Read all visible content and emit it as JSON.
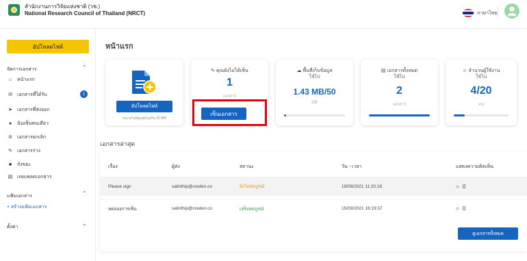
{
  "header": {
    "org_th": "สำนักงานการวิจัยแห่งชาติ (วช.)",
    "org_en": "National Research Council of Thailand (NRCT)",
    "language": "ภาษาไทย"
  },
  "sidebar": {
    "upload_label": "อัปโหลดไฟล์",
    "manage_section": "จัดการเอกสาร",
    "items": [
      {
        "label": "หน้าแรก",
        "icon": "home-icon"
      },
      {
        "label": "เอกสารที่ได้รับ",
        "icon": "inbox-icon",
        "badge": "1"
      },
      {
        "label": "เอกสารที่ส่งออก",
        "icon": "send-icon"
      },
      {
        "label": "ฉันเซ็นคนเดียว",
        "icon": "person-icon"
      },
      {
        "label": "เอกสารยกเลิก",
        "icon": "cancel-icon"
      },
      {
        "label": "เอกสารร่าง",
        "icon": "draft-icon"
      },
      {
        "label": "ถังขยะ",
        "icon": "trash-icon"
      },
      {
        "label": "เทมเพลตเอกสาร",
        "icon": "template-icon"
      }
    ],
    "template_section": "แฟ้มเอกสาร",
    "create_template": "+ สร้างแฟ้มเอกสาร",
    "settings_section": "ตั้งค่า"
  },
  "main": {
    "page_title": "หน้าแรก",
    "upload_card": {
      "button": "อัปโหลดไฟล์",
      "hint": "ขนาดไฟล์สูงสุดไม่เกิน 25 MB"
    },
    "stats": [
      {
        "label": "คุณยังไม่ได้เซ็น",
        "sublabel": "",
        "value": "1",
        "unit": "เอกสาร",
        "fill": 0
      },
      {
        "label": "พื้นที่เก็บข้อมูล",
        "sublabel": "ใช้ไป",
        "value": "1.43 MB/50",
        "unit": "GB",
        "fill": 0.03
      },
      {
        "label": "เอกสารทั้งหมด",
        "sublabel": "ใช้ไป",
        "value": "2",
        "unit": "เอกสาร",
        "fill": 1
      },
      {
        "label": "จำนวนผู้ใช้งาน",
        "sublabel": "ใช้ไป",
        "value": "4/20",
        "unit": "คน",
        "fill": 0.2
      }
    ],
    "sign_button": "เซ็นเอกสาร",
    "recent_title": "เอกสารล่าสุด",
    "table": {
      "headers": [
        "เรื่อง",
        "ผู้ส่ง",
        "สถานะ",
        "วัน - เวลา",
        "แสดงความคิดเห็น"
      ],
      "rows": [
        {
          "subject": "Please sign",
          "sender": "salinthip@creden.co",
          "status": "ยังไม่สมบูรณ์",
          "datetime": "19/09/2021 11:20:16",
          "comments": "0"
        },
        {
          "subject": "ทดลองการเซ็น",
          "sender": "salinthip@creden.co",
          "status": "เสร็จสมบูรณ์",
          "datetime": "15/09/2021 16:19:37",
          "comments": "0"
        }
      ]
    },
    "view_all": "ดูเอกสารทั้งหมด"
  },
  "colors": {
    "primary": "#1565c0",
    "accent_yellow": "#f7c400",
    "highlight_red": "#e8000b",
    "pending": "#d4a000",
    "done": "#2e9e4f"
  }
}
